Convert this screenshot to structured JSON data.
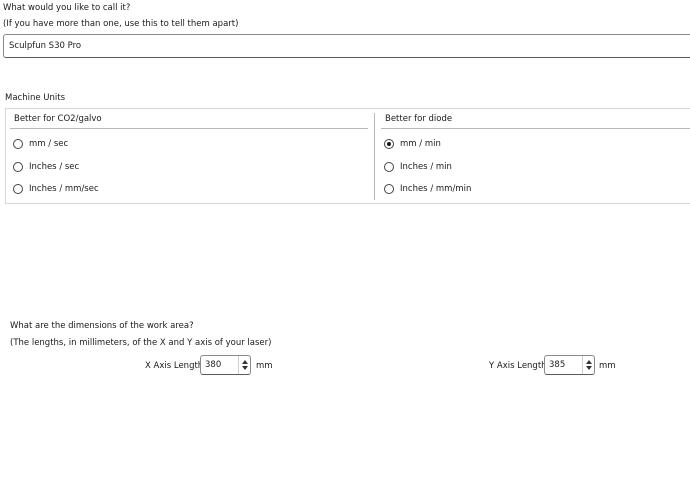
{
  "name_section": {
    "question": "What would you like to call it?",
    "hint": "(If you have more than one, use this to tell them apart)",
    "value": "Sculpfun S30 Pro"
  },
  "units_section": {
    "title": "Machine Units",
    "left_group": {
      "heading": "Better for CO2/galvo",
      "options": [
        "mm / sec",
        "Inches / sec",
        "Inches / mm/sec"
      ]
    },
    "right_group": {
      "heading": "Better for diode",
      "options": [
        "mm / min",
        "Inches / min",
        "Inches / mm/min"
      ]
    },
    "selected": "mm / min"
  },
  "work_area": {
    "question": "What are the dimensions of the work area?",
    "hint": "(The lengths, in millimeters, of the X and Y axis of your laser)",
    "x_label": "X Axis Length",
    "x_value": "380",
    "y_label": "Y Axis Length",
    "y_value": "385",
    "unit": "mm"
  }
}
